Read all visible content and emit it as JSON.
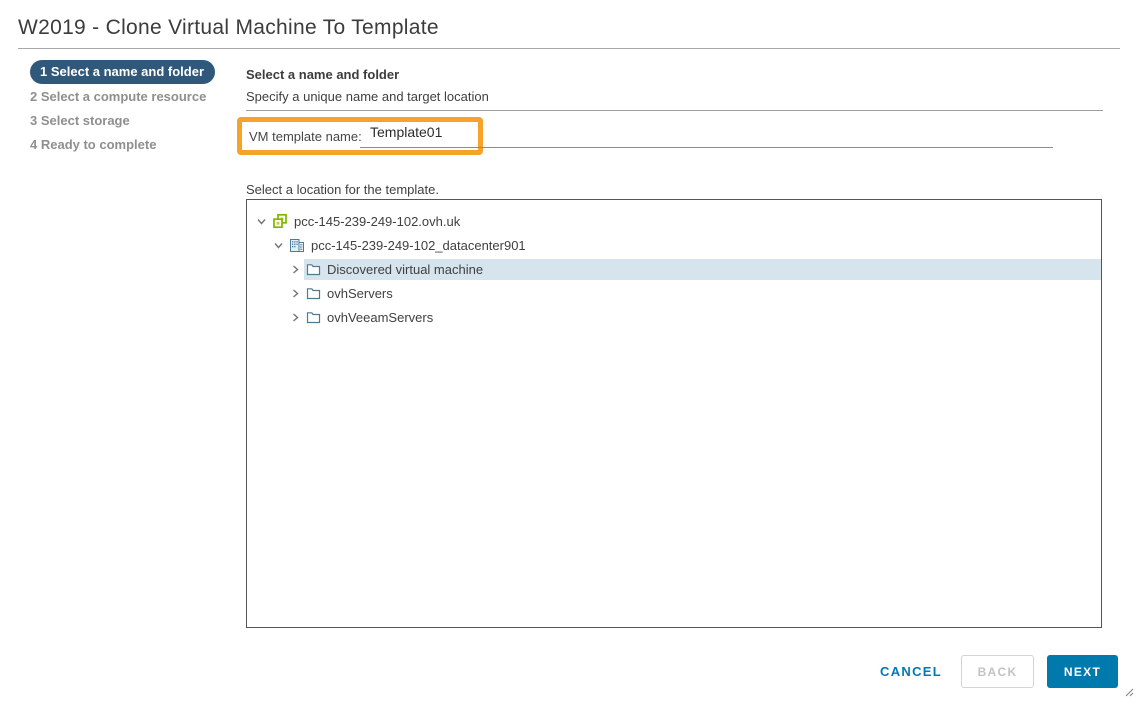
{
  "window": {
    "title": "W2019 - Clone Virtual Machine To Template"
  },
  "steps": [
    {
      "label": "1 Select a name and folder",
      "active": true
    },
    {
      "label": "2 Select a compute resource",
      "active": false
    },
    {
      "label": "3 Select storage",
      "active": false
    },
    {
      "label": "4 Ready to complete",
      "active": false
    }
  ],
  "content": {
    "heading": "Select a name and folder",
    "subheading": "Specify a unique name and target location",
    "name_field": {
      "label": "VM template name:",
      "value": "Template01"
    },
    "location_label": "Select a location for the template.",
    "tree": [
      {
        "label": "pcc-145-239-249-102.ovh.uk",
        "icon": "vcenter-icon",
        "expanded": true,
        "level": 0,
        "selected": false
      },
      {
        "label": "pcc-145-239-249-102_datacenter901",
        "icon": "datacenter-icon",
        "expanded": true,
        "level": 1,
        "selected": false
      },
      {
        "label": "Discovered virtual machine",
        "icon": "folder-icon",
        "expanded": false,
        "level": 2,
        "selected": true
      },
      {
        "label": "ovhServers",
        "icon": "folder-icon",
        "expanded": false,
        "level": 2,
        "selected": false
      },
      {
        "label": "ovhVeeamServers",
        "icon": "folder-icon",
        "expanded": false,
        "level": 2,
        "selected": false
      }
    ]
  },
  "footer": {
    "cancel_label": "CANCEL",
    "back_label": "BACK",
    "next_label": "NEXT"
  },
  "colors": {
    "annotation_orange": "#F5A32B",
    "active_step_navy": "#30587A",
    "primary_button_blue": "#0079AD",
    "cancel_link_blue": "#0079B8",
    "tree_selection": "#D5E4ED",
    "icon_green": "#7AB800",
    "icon_orange": "#F8B133",
    "icon_steel_blue": "#4E7B93"
  }
}
